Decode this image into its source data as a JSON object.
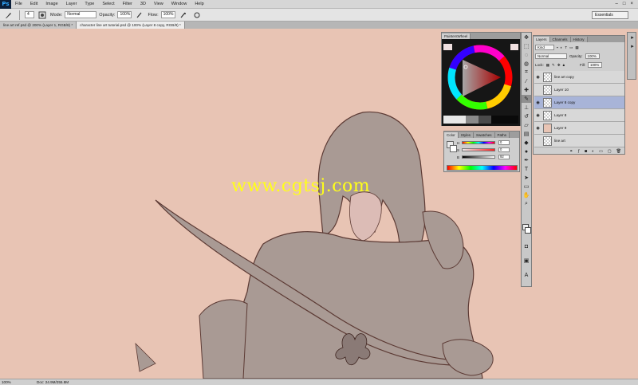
{
  "app": {
    "logo": "Ps",
    "menu": [
      "File",
      "Edit",
      "Image",
      "Layer",
      "Type",
      "Select",
      "Filter",
      "3D",
      "View",
      "Window",
      "Help"
    ],
    "window_controls": [
      "–",
      "□",
      "×"
    ]
  },
  "options": {
    "mode_label": "Mode:",
    "mode_value": "Normal",
    "opacity_label": "Opacity:",
    "opacity_value": "100%",
    "flow_label": "Flow:",
    "flow_value": "100%",
    "workspace": "Essentials",
    "brush_size": "4"
  },
  "tabs": [
    {
      "label": "line art ref.psd @ 200% (Layer 1, RGB/8) *",
      "active": false
    },
    {
      "label": "character line art tutorial.psd @ 100% (Layer 8 copy, RGB/8) *",
      "active": true
    }
  ],
  "canvas": {
    "background": "#e8c4b4",
    "watermark": "www.cgtsj.com"
  },
  "status": {
    "zoom": "100%",
    "doc_info": "Doc: 24.9M/255.8M"
  },
  "wheel_panel": {
    "tab": "PaintersWheel"
  },
  "color_panel": {
    "tabs": [
      "Color",
      "Styles",
      "Swatches",
      "Paths"
    ],
    "sliders": [
      {
        "letter": "H",
        "value": "0"
      },
      {
        "letter": "S",
        "value": "0"
      },
      {
        "letter": "B",
        "value": "92"
      }
    ]
  },
  "tools": [
    "move-icon",
    "marquee-icon",
    "lasso-icon",
    "quick-select-icon",
    "crop-icon",
    "eyedropper-icon",
    "healing-icon",
    "brush-icon",
    "stamp-icon",
    "history-brush-icon",
    "eraser-icon",
    "gradient-icon",
    "blur-icon",
    "dodge-icon",
    "pen-icon",
    "type-icon",
    "path-select-icon",
    "shape-icon",
    "hand-icon",
    "zoom-icon"
  ],
  "layers_panel": {
    "tabs": [
      "Layers",
      "Channels",
      "History"
    ],
    "kind_label": "Kind",
    "blend_mode": "Normal",
    "opacity_label": "Opacity:",
    "opacity_value": "100%",
    "lock_label": "Lock:",
    "fill_label": "Fill:",
    "fill_value": "100%",
    "layers": [
      {
        "name": "line art copy",
        "visible": true,
        "selected": false,
        "thumb": "transparent"
      },
      {
        "name": "Layer 10",
        "visible": false,
        "selected": false,
        "thumb": "transparent"
      },
      {
        "name": "Layer 8 copy",
        "visible": true,
        "selected": true,
        "thumb": "transparent"
      },
      {
        "name": "Layer 8",
        "visible": true,
        "selected": false,
        "thumb": "transparent"
      },
      {
        "name": "Layer 9",
        "visible": true,
        "selected": false,
        "thumb": "flesh"
      },
      {
        "name": "line art",
        "visible": false,
        "selected": false,
        "thumb": "transparent"
      }
    ],
    "footer_icons": [
      "link-icon",
      "fx-icon",
      "mask-icon",
      "adjustment-icon",
      "folder-icon",
      "new-layer-icon",
      "trash-icon"
    ]
  }
}
